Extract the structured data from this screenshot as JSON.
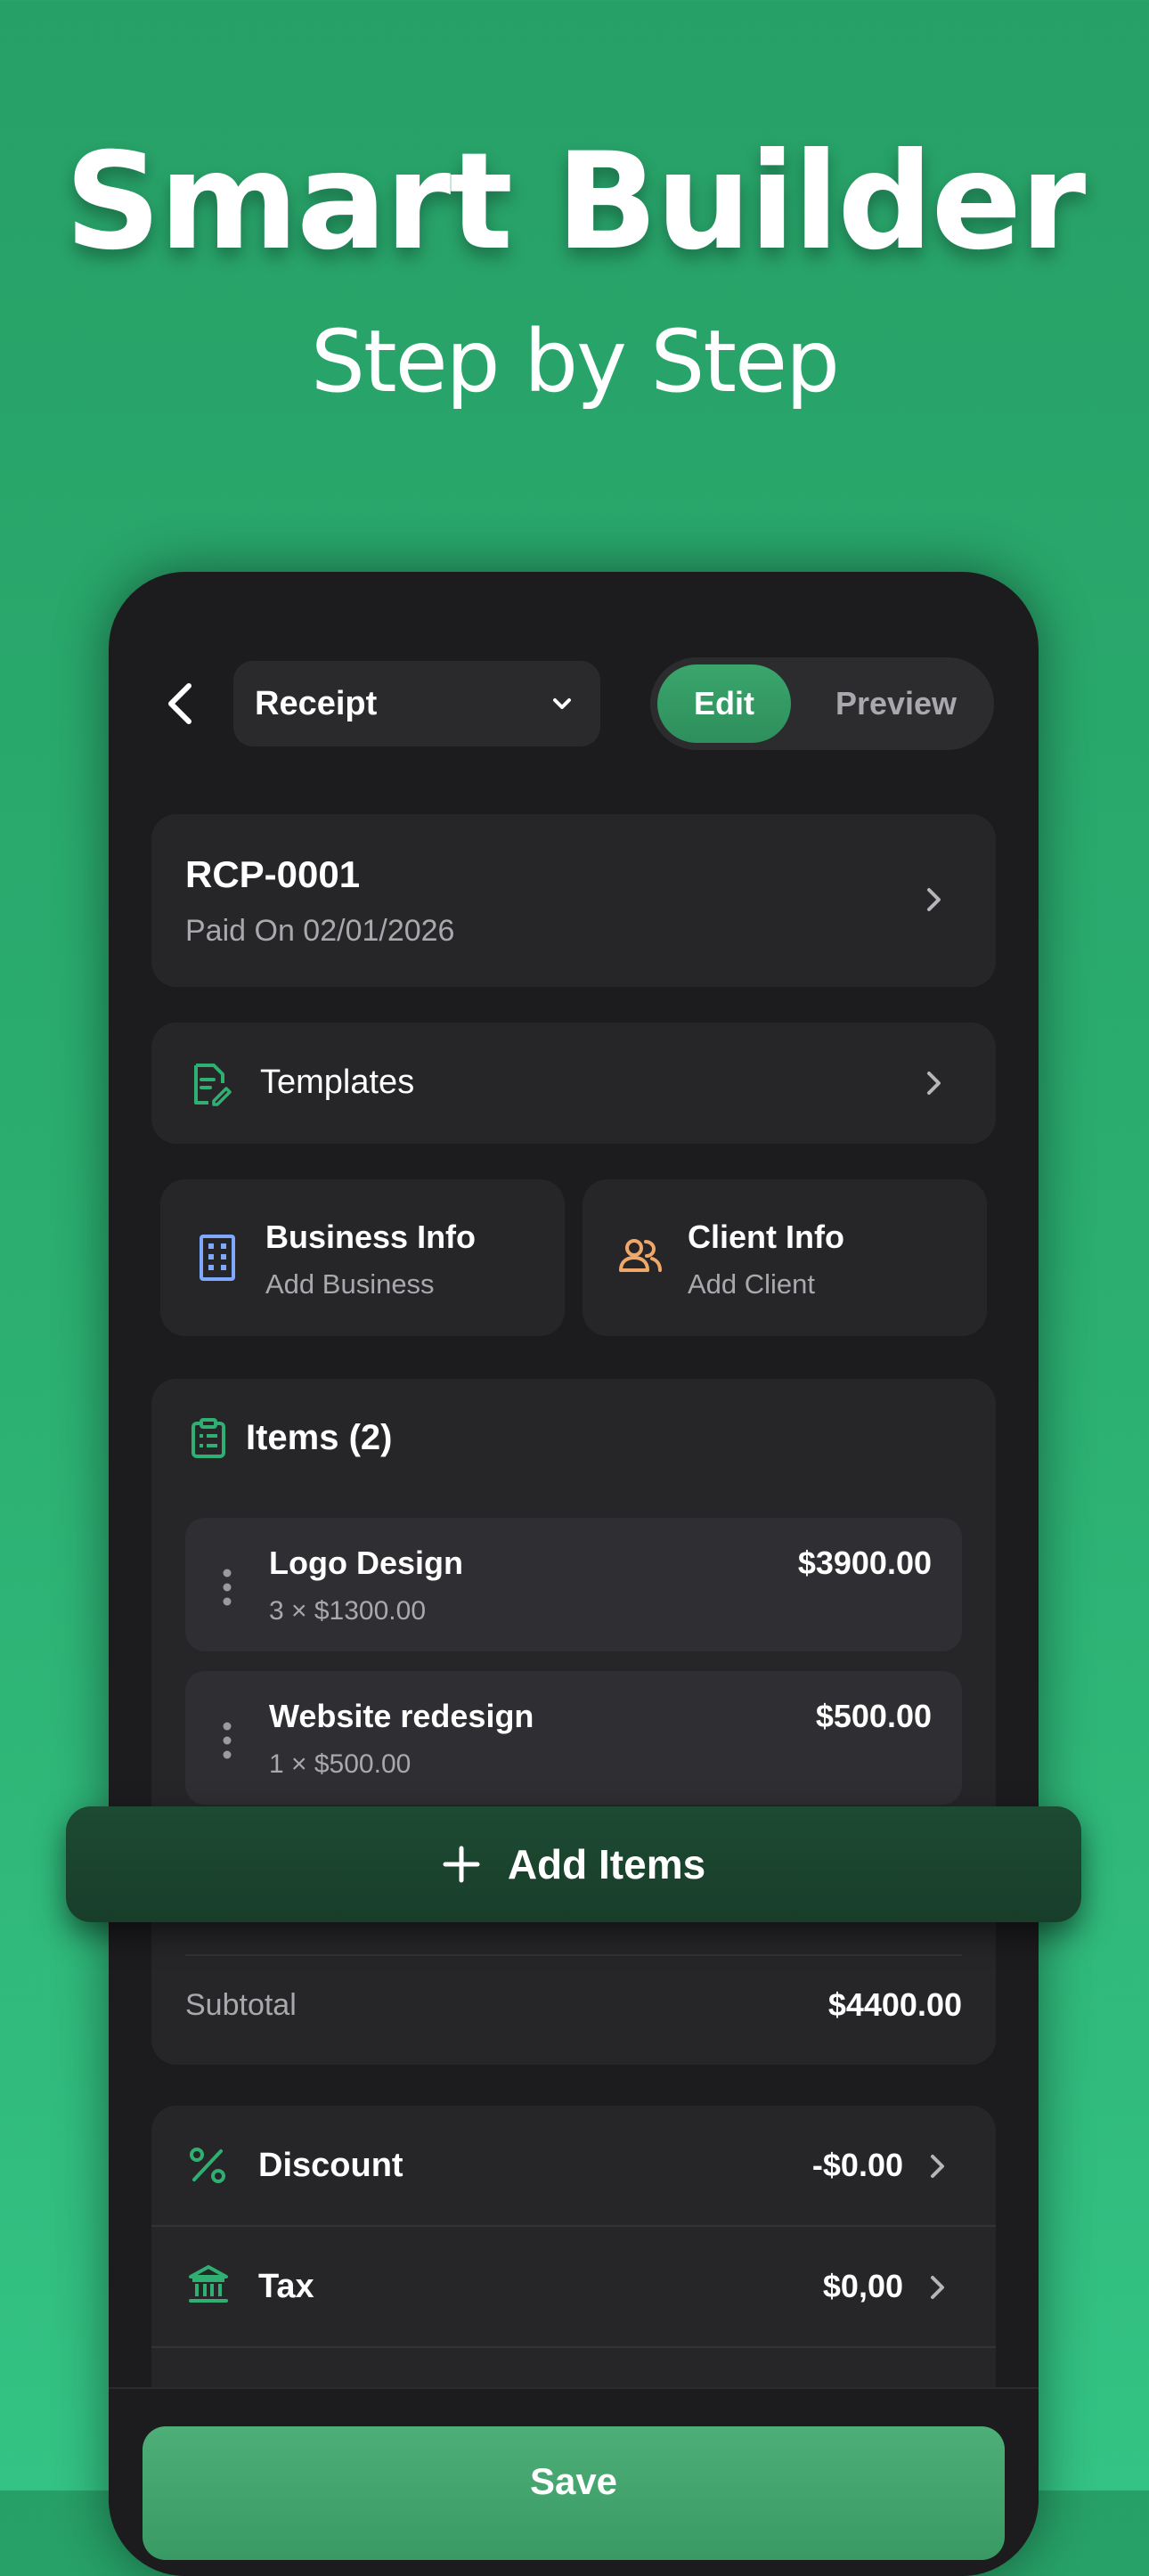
{
  "promo": {
    "headline": "Smart Builder",
    "subheadline": "Step by Step"
  },
  "topbar": {
    "document_type": "Receipt",
    "modes": {
      "edit": "Edit",
      "preview": "Preview",
      "active": "edit"
    }
  },
  "receipt": {
    "number": "RCP-0001",
    "status_line": "Paid On 02/01/2026"
  },
  "templates": {
    "label": "Templates"
  },
  "business": {
    "title": "Business Info",
    "subtitle": "Add Business"
  },
  "client": {
    "title": "Client Info",
    "subtitle": "Add Client"
  },
  "items": {
    "title": "Items (2)",
    "list": [
      {
        "name": "Logo Design",
        "detail": "3 × $1300.00",
        "total": "$3900.00"
      },
      {
        "name": "Website redesign",
        "detail": "1 × $500.00",
        "total": "$500.00"
      }
    ],
    "add_label": "Add Items",
    "subtotal_label": "Subtotal",
    "subtotal_value": "$4400.00"
  },
  "adjustments": {
    "discount": {
      "label": "Discount",
      "value": "-$0.00"
    },
    "tax": {
      "label": "Tax",
      "value": "$0,00"
    }
  },
  "actions": {
    "save": "Save"
  },
  "colors": {
    "background_green": "#2bae70",
    "accent_green": "#3aa56c",
    "icon_green": "#2fb072",
    "business_icon_blue": "#7fa8ff",
    "client_icon_orange": "#f0a86a",
    "card_dark": "#262629",
    "phone_dark": "#1c1c1e"
  }
}
